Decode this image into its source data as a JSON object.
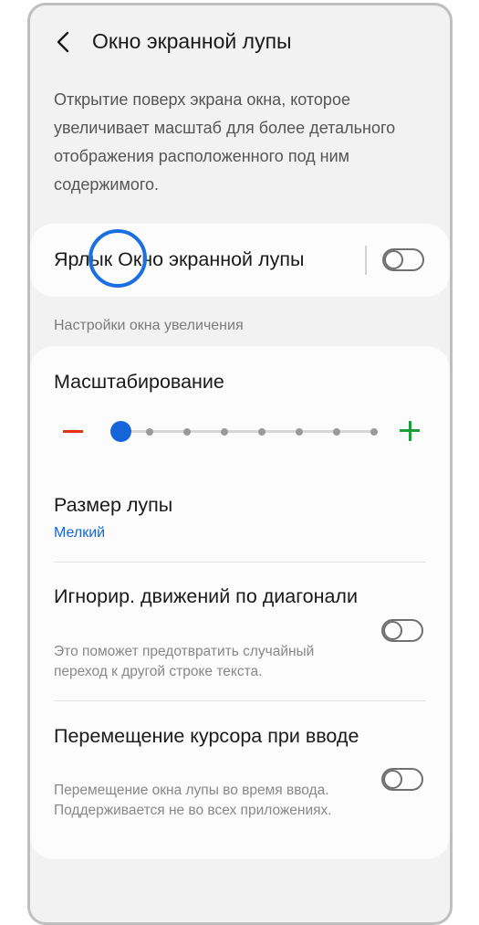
{
  "header": {
    "back_icon": "chevron-left-icon",
    "title": "Окно экранной лупы"
  },
  "description": "Открытие поверх экрана окна, которое увеличивает масштаб для более детального отображения расположенного под ним содержимого.",
  "shortcut": {
    "label": "Ярлык Окно экранной лупы",
    "enabled": false
  },
  "section_header": "Настройки окна увеличения",
  "zoom": {
    "label": "Масштабирование",
    "level": 1,
    "steps": 8,
    "minus_icon": "minus-icon",
    "plus_icon": "plus-icon"
  },
  "magnifier_size": {
    "label": "Размер лупы",
    "value": "Мелкий"
  },
  "ignore_diagonal": {
    "label": "Игнорир. движений по диагонали",
    "description": "Это поможет предотвратить случайный переход к другой строке текста.",
    "enabled": false
  },
  "follow_typing": {
    "label": "Перемещение курсора при вводе",
    "description": "Перемещение окна лупы во время ввода. Поддерживается не во всех приложениях.",
    "enabled": false
  },
  "colors": {
    "accent": "#1565d8",
    "minus": "#e0360f",
    "plus": "#1e9e3a",
    "highlight": "#1b6fe0"
  }
}
